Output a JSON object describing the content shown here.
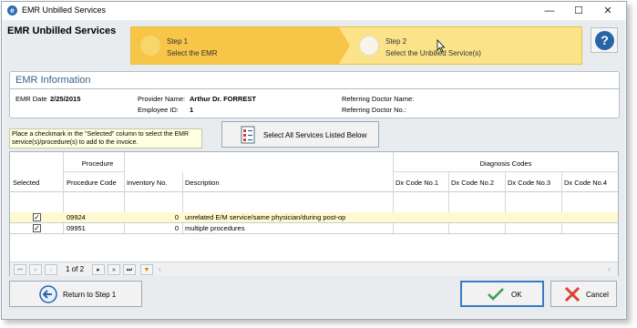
{
  "window": {
    "title": "EMR Unbilled Services",
    "minimize": "—",
    "maximize": "☐",
    "close": "✕"
  },
  "page_title": "EMR Unbilled Services",
  "wizard": {
    "step1": {
      "title": "Step 1",
      "subtitle": "Select the EMR"
    },
    "step2": {
      "title": "Step 2",
      "subtitle": "Select the Unbilled Service(s)"
    }
  },
  "help": {
    "label": "?"
  },
  "emr_info": {
    "heading": "EMR Information",
    "emr_date_label": "EMR Date",
    "emr_date": "2/25/2015",
    "provider_label": "Provider Name:",
    "provider": "Arthur Dr. FORREST",
    "employee_label": "Employee ID:",
    "employee_id": "1",
    "ref_name_label": "Referring Doctor Name:",
    "ref_no_label": "Referring Doctor No.:"
  },
  "hint": "Place a checkmark in the \"Selected\" column to select the EMR service(s)/procedure(s) to add to the invoice.",
  "select_all_label": "Select All Services Listed Below",
  "grid": {
    "group_headers": {
      "procedure": "Procedure",
      "diagnosis": "Diagnosis Codes"
    },
    "columns": {
      "selected": "Selected",
      "procedure_code": "Procedure Code",
      "inventory": "Inventory No.",
      "description": "Description",
      "dx1": "Dx Code No.1",
      "dx2": "Dx Code No.2",
      "dx3": "Dx Code No.3",
      "dx4": "Dx Code No.4"
    },
    "rows": [
      {
        "selected": "✓",
        "code": "09924",
        "inventory": "0",
        "description": "unrelated E/M service/same physician/during post-op"
      },
      {
        "selected": "✓",
        "code": "09951",
        "inventory": "0",
        "description": "multiple procedures"
      }
    ],
    "pager": {
      "page_text": "1 of 2"
    }
  },
  "buttons": {
    "return": "Return to Step 1",
    "ok": "OK",
    "cancel": "Cancel"
  },
  "colors": {
    "accent": "#2a64a8",
    "wizard_active": "#f7c548",
    "wizard_bg": "#fbe389"
  }
}
